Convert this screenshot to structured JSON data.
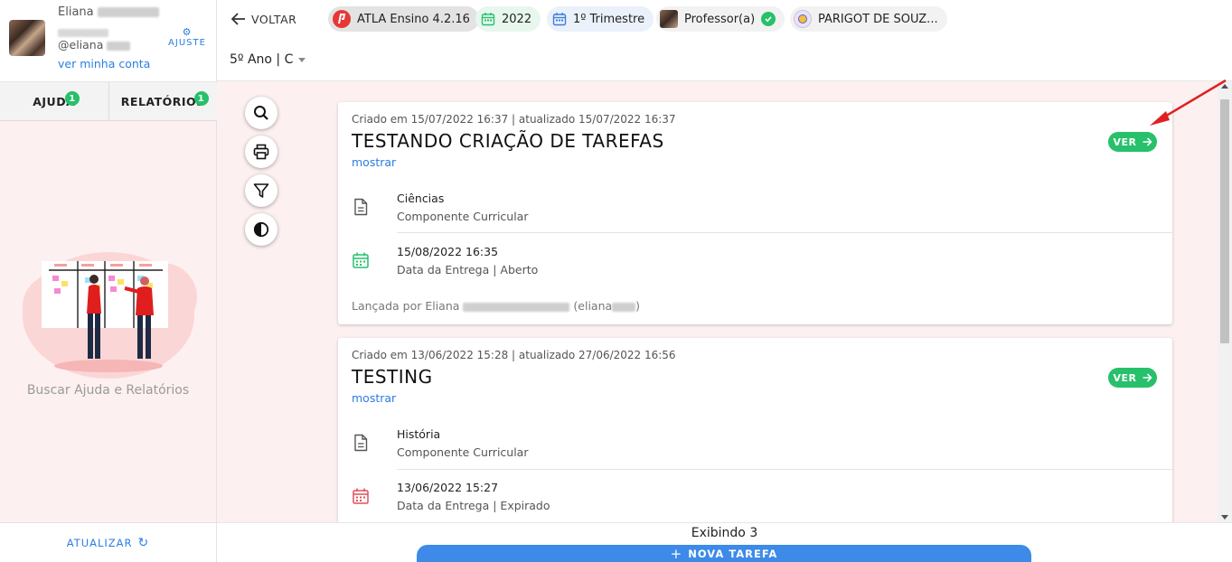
{
  "user": {
    "first_name": "Eliana",
    "handle": "@eliana",
    "account_link": "ver minha conta",
    "settings_label": "AJUSTE"
  },
  "side_tabs": [
    {
      "label": "AJUDA",
      "badge": "1"
    },
    {
      "label": "RELATÓRIOS",
      "badge": "1"
    }
  ],
  "sidebar": {
    "help_caption": "Buscar Ajuda e Relatórios",
    "refresh_label": "ATUALIZAR"
  },
  "topbar": {
    "back_label": "VOLTAR",
    "chips": {
      "app": "ATLA Ensino 4.2.16",
      "year": "2022",
      "term": "1º Trimestre",
      "role": "Professor(a)",
      "school": "PARIGOT DE SOUZ..."
    },
    "class_select": "5º Ano | C"
  },
  "tasks": [
    {
      "meta": "Criado em 15/07/2022 16:37 | atualizado 15/07/2022 16:37",
      "title": "TESTANDO CRIAÇÃO DE TAREFAS",
      "show_label": "mostrar",
      "view_label": "VER",
      "subject": "Ciências",
      "subject_caption": "Componente Curricular",
      "due": "15/08/2022 16:35",
      "due_caption": "Data da Entrega | Aberto",
      "due_status_color": "#27c06b",
      "footer_prefix": "Lançada por Eliana",
      "footer_suffix": "(eliana",
      "footer_end": ")"
    },
    {
      "meta": "Criado em 13/06/2022 15:28 | atualizado 27/06/2022 16:56",
      "title": "TESTING",
      "show_label": "mostrar",
      "view_label": "VER",
      "subject": "História",
      "subject_caption": "Componente Curricular",
      "due": "13/06/2022 15:27",
      "due_caption": "Data da Entrega | Expirado",
      "due_status_color": "#e0505a"
    }
  ],
  "footer": {
    "count_label": "Exibindo 3",
    "new_task_label": "NOVA TAREFA"
  },
  "colors": {
    "accent": "#2b7de1",
    "success": "#27c06b",
    "danger": "#e0505a",
    "primary_button": "#3d8ae8",
    "annotation": "#e02020"
  },
  "icons": {
    "tools": [
      "search-icon",
      "print-icon",
      "filter-icon",
      "contrast-icon"
    ]
  }
}
